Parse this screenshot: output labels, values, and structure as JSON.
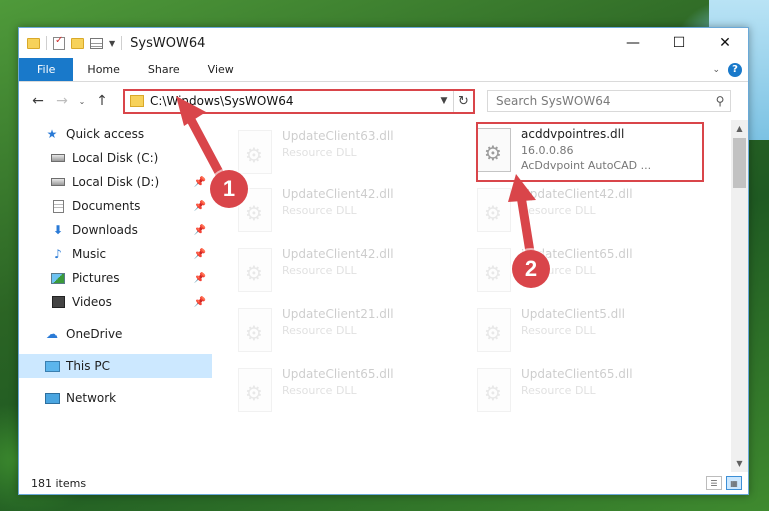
{
  "window": {
    "title": "SysWOW64",
    "controls": {
      "minimize": "—",
      "maximize": "☐",
      "close": "✕"
    }
  },
  "ribbon": {
    "tabs": [
      "File",
      "Home",
      "Share",
      "View"
    ],
    "help": "?"
  },
  "navbar": {
    "back": "←",
    "forward": "→",
    "recent": "⌄",
    "up": "↑",
    "address": "C:\\Windows\\SysWOW64",
    "refresh": "↻",
    "search_placeholder": "Search SysWOW64"
  },
  "sidebar": {
    "quick_access": "Quick access",
    "items": [
      {
        "label": "Local Disk (C:)",
        "icon": "disk-icon"
      },
      {
        "label": "Local Disk (D:)",
        "icon": "disk-icon"
      },
      {
        "label": "Documents",
        "icon": "document-icon"
      },
      {
        "label": "Downloads",
        "icon": "download-icon"
      },
      {
        "label": "Music",
        "icon": "music-icon"
      },
      {
        "label": "Pictures",
        "icon": "pictures-icon"
      },
      {
        "label": "Videos",
        "icon": "videos-icon"
      }
    ],
    "onedrive": "OneDrive",
    "this_pc": "This PC",
    "network": "Network"
  },
  "files": [
    {
      "name": "UpdateClient63.dll",
      "desc": "Resource DLL"
    },
    {
      "name": "acddvpointres.dll",
      "version": "16.0.0.86",
      "desc": "AcDdvpoint AutoCAD ..."
    },
    {
      "name": "UpdateClient42.dll",
      "desc": "Resource DLL"
    },
    {
      "name": "UpdateClient42.dll",
      "desc": "Resource DLL"
    },
    {
      "name": "UpdateClient42.dll",
      "desc": "Resource DLL"
    },
    {
      "name": "UpdateClient65.dll",
      "desc": "Resource DLL"
    },
    {
      "name": "UpdateClient21.dll",
      "desc": "Resource DLL"
    },
    {
      "name": "UpdateClient5.dll",
      "desc": "Resource DLL"
    },
    {
      "name": "UpdateClient65.dll",
      "desc": "Resource DLL"
    },
    {
      "name": "UpdateClient65.dll",
      "desc": "Resource DLL"
    }
  ],
  "status": {
    "count": "181 items"
  },
  "annotations": {
    "badge1": "1",
    "badge2": "2",
    "color": "#d9454a"
  }
}
